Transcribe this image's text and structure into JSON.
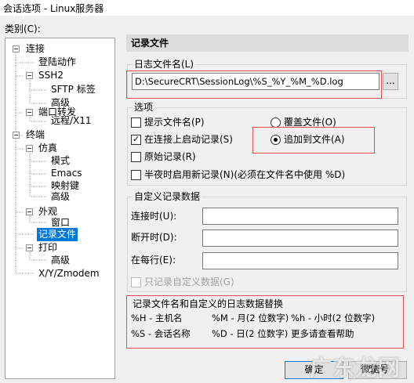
{
  "window": {
    "title": "会话选项 - Linux服务器"
  },
  "category_label": "类别(C):",
  "tree": {
    "items": [
      {
        "label": "连接"
      },
      {
        "label": "登陆动作"
      },
      {
        "label": "SSH2"
      },
      {
        "label": "SFTP 标签"
      },
      {
        "label": "高级"
      },
      {
        "label": "端口转发"
      },
      {
        "label": "远程/X11"
      },
      {
        "label": "终端"
      },
      {
        "label": "仿真"
      },
      {
        "label": "模式"
      },
      {
        "label": "Emacs"
      },
      {
        "label": "映射键"
      },
      {
        "label": "高级"
      },
      {
        "label": "外观"
      },
      {
        "label": "窗口"
      },
      {
        "label": "记录文件"
      },
      {
        "label": "打印"
      },
      {
        "label": "高级"
      },
      {
        "label": "X/Y/Zmodem"
      }
    ]
  },
  "section_title": "记录文件",
  "logfile": {
    "group_label": "日志文件名(L)",
    "value": "D:\\SecureCRT\\SessionLog\\%S_%Y_%M_%D.log",
    "browse_label": "..."
  },
  "options": {
    "group_label": "选项",
    "prompt_filename": "提示文件名(P)",
    "start_on_connect": "在连接上启动记录(S)",
    "raw_log": "原始记录(R)",
    "midnight_new_log": "半夜时启用新记录(N)(必须在文件名中使用 %D)",
    "overwrite_file": "覆盖文件(O)",
    "append_file": "追加到文件(A)"
  },
  "custom": {
    "group_label": "自定义记录数据",
    "on_connect": "连接时(U):",
    "on_disconnect": "断开时(D):",
    "each_line": "在每行(E):",
    "only_custom": "只记录自定义数据(G)"
  },
  "subst": {
    "title": "记录文件名和自定义的日志数据替换",
    "r1c1": "%H - 主机名",
    "r1c2": "%M - 月(2 位数字)",
    "r1c3": "%h - 小时(2 位数字)",
    "r2c1": "%S - 会话名称",
    "r2c2": "%D - 日(2 位数字)",
    "r2c3": "更多请查看帮助"
  },
  "buttons": {
    "ok": "确定",
    "cancel": "取消"
  },
  "watermark": {
    "main": "广东龙网",
    "small": "微信号"
  },
  "colors": {
    "selection": "#0078d7",
    "highlight_box": "#e05050",
    "header_bg": "#dcdcdc"
  }
}
